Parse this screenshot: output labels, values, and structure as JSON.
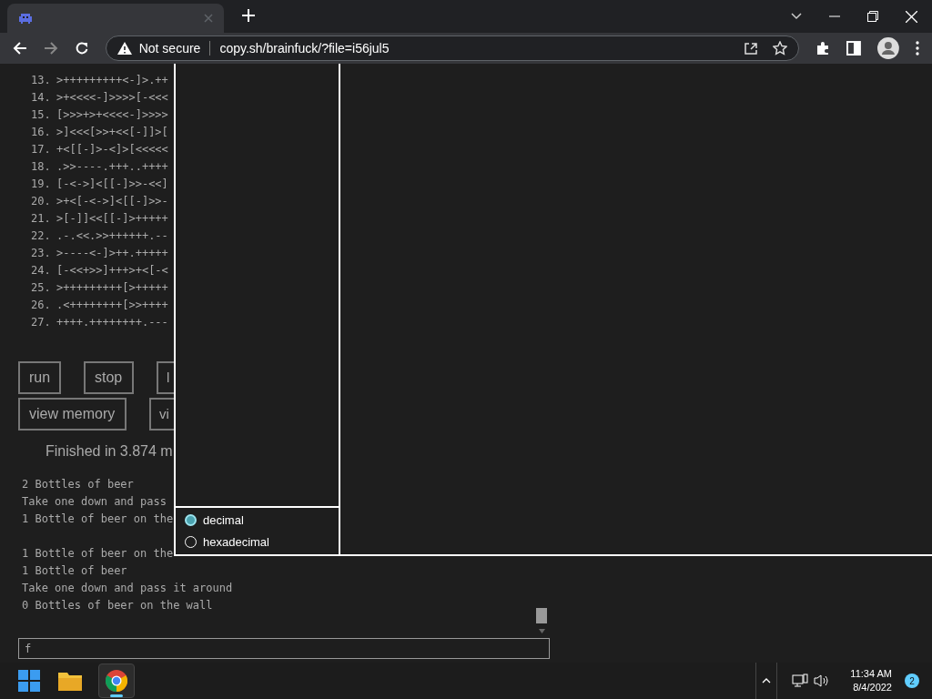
{
  "browser": {
    "address": {
      "security": "Not secure",
      "url": "copy.sh/brainfuck/?file=i56jul5"
    }
  },
  "code_lines": [
    {
      "number": "13.",
      "code": ">+++++++++<-]>.++"
    },
    {
      "number": "14.",
      "code": ">+<<<<-]>>>>[-<<<"
    },
    {
      "number": "15.",
      "code": "[>>>+>+<<<<-]>>>>"
    },
    {
      "number": "16.",
      "code": ">]<<<[>>+<<[-]]>["
    },
    {
      "number": "17.",
      "code": "+<[[-]>-<]>[<<<<<"
    },
    {
      "number": "18.",
      "code": ".>>----.+++..++++"
    },
    {
      "number": "19.",
      "code": "[-<->]<[[-]>>-<<]"
    },
    {
      "number": "20.",
      "code": ">+<[-<->]<[[-]>>-"
    },
    {
      "number": "21.",
      "code": ">[-]]<<[[-]>+++++"
    },
    {
      "number": "22.",
      "code": ".-.<<.>>++++++.--"
    },
    {
      "number": "23.",
      "code": ">----<-]>++.+++++"
    },
    {
      "number": "24.",
      "code": "[-<<+>>]+++>+<[-<"
    },
    {
      "number": "25.",
      "code": ">+++++++++[>+++++"
    },
    {
      "number": "26.",
      "code": ".<++++++++[>>++++"
    },
    {
      "number": "27.",
      "code": "++++.++++++++.---"
    }
  ],
  "buttons": [
    [
      "run",
      "stop",
      "l"
    ],
    [
      "view memory",
      "vi"
    ]
  ],
  "status": "Finished in 3.874 m",
  "output_stanzas": [
    [
      "2 Bottles of beer",
      "Take one down and pass",
      "1 Bottle of beer on the"
    ],
    [
      "1 Bottle of beer on the",
      "1 Bottle of beer",
      "Take one down and pass it around",
      "0 Bottles of beer on the wall"
    ]
  ],
  "input": {
    "value": "f"
  },
  "memory_panel": {
    "radios": [
      {
        "label": "decimal",
        "selected": true
      },
      {
        "label": "hexadecimal",
        "selected": false
      }
    ]
  },
  "taskbar": {
    "time": "11:34 AM",
    "date": "8/4/2022",
    "notifications": "2"
  }
}
